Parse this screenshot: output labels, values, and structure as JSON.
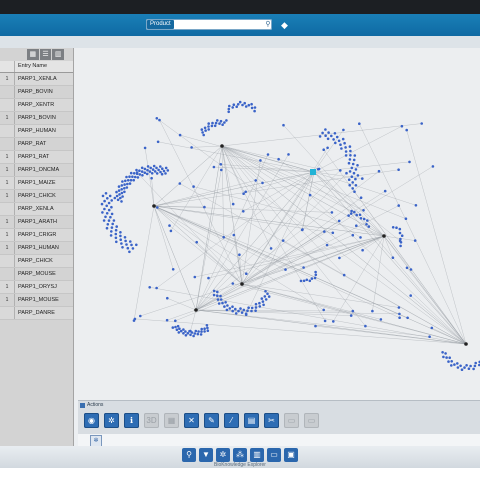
{
  "window": {
    "search": {
      "scope": "Product",
      "value": ""
    },
    "tag_icon": "tag-icon"
  },
  "left_panel": {
    "view_toggle": [
      "table-grid-icon",
      "list-icon",
      "columns-icon"
    ],
    "table": {
      "header": [
        "",
        "Entry Name"
      ],
      "rows": [
        [
          "1",
          "PARP1_XENLA"
        ],
        [
          "",
          "PARP_BOVIN"
        ],
        [
          "",
          "PARP_XENTR"
        ],
        [
          "1",
          "PARP1_BOVIN"
        ],
        [
          "",
          "PARP_HUMAN"
        ],
        [
          "",
          "PARP_RAT"
        ],
        [
          "1",
          "PARP1_RAT"
        ],
        [
          "1",
          "PARP1_ONCMA"
        ],
        [
          "1",
          "PARP1_MAIZE"
        ],
        [
          "1",
          "PARP1_CHICK"
        ],
        [
          "",
          "PARP_XENLA"
        ],
        [
          "1",
          "PARP1_ARATH"
        ],
        [
          "1",
          "PARP1_CRIGR"
        ],
        [
          "1",
          "PARP1_HUMAN"
        ],
        [
          "",
          "PARP_CHICK"
        ],
        [
          "",
          "PARP_MOUSE"
        ],
        [
          "1",
          "PARP1_ORYSJ"
        ],
        [
          "1",
          "PARP1_MOUSE"
        ],
        [
          "",
          "PARP_DANRE"
        ]
      ]
    }
  },
  "actions": {
    "title": "Actions",
    "buttons": [
      {
        "icon": "eye-icon",
        "glyph": "◉",
        "enabled": true
      },
      {
        "icon": "network-icon",
        "glyph": "✲",
        "enabled": true
      },
      {
        "icon": "info-icon",
        "glyph": "ℹ",
        "enabled": true
      },
      {
        "icon": "3d-icon",
        "glyph": "3D",
        "enabled": false
      },
      {
        "icon": "layout-icon",
        "glyph": "▦",
        "enabled": false
      },
      {
        "icon": "close-icon",
        "glyph": "✕",
        "enabled": true
      },
      {
        "icon": "pen-icon",
        "glyph": "✎",
        "enabled": true
      },
      {
        "icon": "eyedropper-icon",
        "glyph": "⁄",
        "enabled": true
      },
      {
        "icon": "chart-icon",
        "glyph": "▤",
        "enabled": true
      },
      {
        "icon": "scissors-icon",
        "glyph": "✂",
        "enabled": true
      },
      {
        "icon": "export-icon",
        "glyph": "▭",
        "enabled": false
      },
      {
        "icon": "print-icon",
        "glyph": "▭",
        "enabled": false
      }
    ]
  },
  "mini_toolbar": {
    "icon": "network-small-icon"
  },
  "dock": {
    "buttons": [
      {
        "icon": "search-icon",
        "glyph": "⚲"
      },
      {
        "icon": "filter-icon",
        "glyph": "▼"
      },
      {
        "icon": "network-icon",
        "glyph": "✲"
      },
      {
        "icon": "cluster-icon",
        "glyph": "⁂"
      },
      {
        "icon": "bar-chart-icon",
        "glyph": "▥"
      },
      {
        "icon": "window-icon",
        "glyph": "▭"
      },
      {
        "icon": "panel-icon",
        "glyph": "▣"
      }
    ],
    "caption": "BioKnowledge Explorer"
  },
  "colors": {
    "topbar": "#1a7fb7",
    "node": "#3a63c8",
    "edge": "#9aa0a6",
    "highlight_node": "#21b3d6",
    "action_button": "#2e6db4"
  }
}
